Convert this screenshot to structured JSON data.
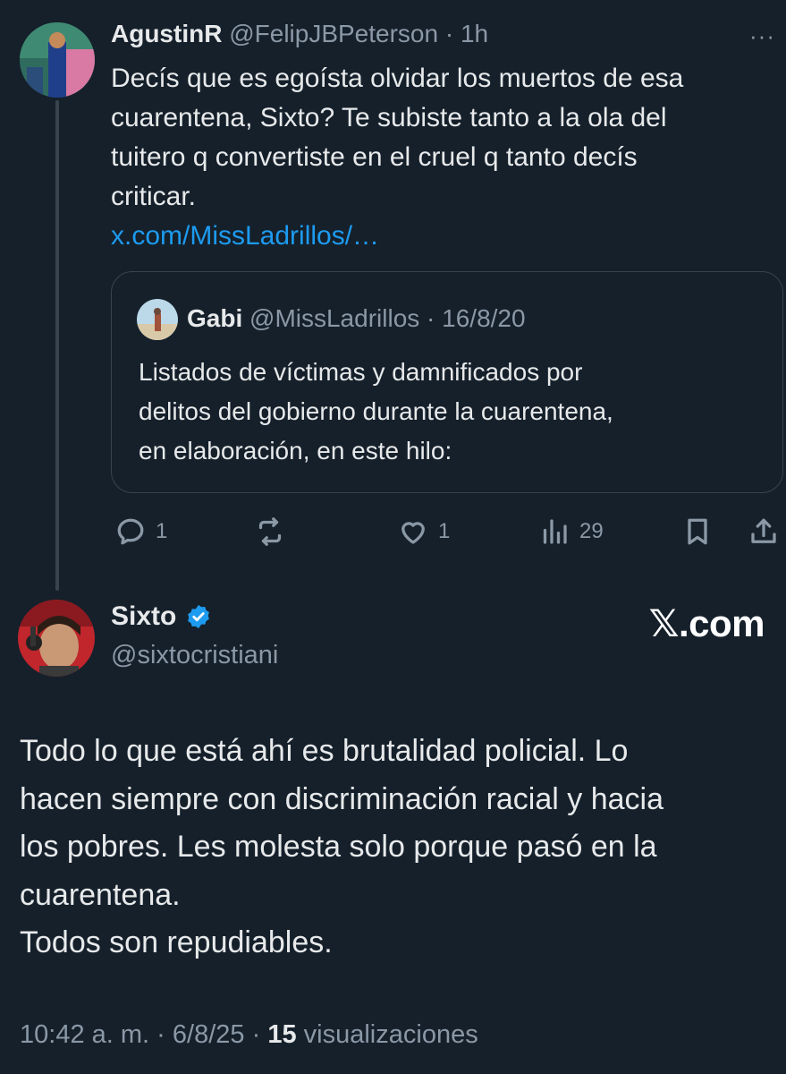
{
  "reply": {
    "display_name": "AgustinR",
    "handle": "@FelipJBPeterson",
    "separator": "·",
    "time": "1h",
    "more_label": "···",
    "text_lines": [
      "Decís que es egoísta olvidar los muertos de esa",
      "cuarentena, Sixto? Te subiste tanto a la ola del",
      "tuitero q convertiste en el cruel q tanto decís",
      "criticar."
    ],
    "link": "x.com/MissLadrillos/…",
    "quote": {
      "display_name": "Gabi",
      "handle": "@MissLadrillos",
      "separator": "·",
      "date": "16/8/20",
      "text_lines": [
        "Listados de víctimas y damnificados por",
        "delitos del gobierno durante la cuarentena,",
        "en elaboración, en este hilo:"
      ]
    },
    "actions": {
      "replies": "1",
      "likes": "1",
      "views": "29"
    }
  },
  "main": {
    "display_name": "Sixto",
    "handle": "@sixtocristiani",
    "brand": "𝕏.com",
    "text_lines": [
      "Todo lo que está ahí es brutalidad policial. Lo",
      "hacen siempre con discriminación racial y hacia",
      "los pobres. Les molesta solo porque pasó en la",
      "cuarentena.",
      "Todos son repudiables."
    ],
    "time": "10:42 a. m.",
    "dot1": "·",
    "date": "6/8/25",
    "dot2": "·",
    "views_count": "15",
    "views_label": "visualizaciones"
  },
  "colors": {
    "background": "#15202b",
    "text": "#e7e9ea",
    "muted": "#8b98a5",
    "link": "#1d9bf0",
    "verified": "#1d9bf0"
  }
}
